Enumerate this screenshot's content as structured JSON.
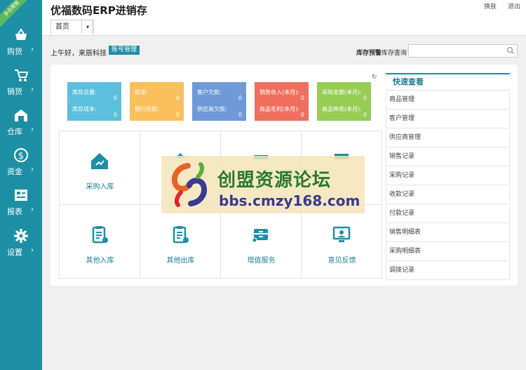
{
  "app": {
    "title": "优福数码ERP进销存",
    "ribbon": "多仓库版"
  },
  "top_links": {
    "switch": "换肤",
    "logout": "退出"
  },
  "tabs": [
    {
      "label": "首页"
    }
  ],
  "greeting": "上午好，来辰科技",
  "account_btn": "账号管理",
  "warning": "库存预警",
  "stock_query": "库存查询",
  "search": {
    "placeholder": "",
    "value": ""
  },
  "sidebar": [
    {
      "label": "购货",
      "icon": "basket-icon"
    },
    {
      "label": "销货",
      "icon": "cart-icon"
    },
    {
      "label": "仓库",
      "icon": "warehouse-icon"
    },
    {
      "label": "资金",
      "icon": "dollar-icon"
    },
    {
      "label": "报表",
      "icon": "report-icon"
    },
    {
      "label": "设置",
      "icon": "gear-icon"
    }
  ],
  "stat_cards": [
    {
      "color": "#5bc0de",
      "l1": "库存总量:",
      "v1": "0",
      "l2": "库存成本:",
      "v2": "0"
    },
    {
      "color": "#f9c05b",
      "l1": "现金:",
      "v1": "0",
      "l2": "银行存款:",
      "v2": "0"
    },
    {
      "color": "#6f9ad7",
      "l1": "客户欠款:",
      "v1": "0",
      "l2": "供应商欠款:",
      "v2": "0"
    },
    {
      "color": "#ef6f5f",
      "l1": "销售收入(本月):",
      "v1": "0",
      "l2": "商品毛利(本月):",
      "v2": "0"
    },
    {
      "color": "#97cc55",
      "l1": "采购金额(本月):",
      "v1": "0",
      "l2": "商品种类(本月):",
      "v2": "0"
    }
  ],
  "grid": [
    {
      "label": "采购入库",
      "icon": "house-icon"
    },
    {
      "label": "",
      "icon": "upload-icon"
    },
    {
      "label": "",
      "icon": "box-icon"
    },
    {
      "label": "",
      "icon": "screen-icon"
    },
    {
      "label": "其他入库",
      "icon": "clipboard-in-icon"
    },
    {
      "label": "其他出库",
      "icon": "clipboard-out-icon"
    },
    {
      "label": "增值服务",
      "icon": "cabinet-icon"
    },
    {
      "label": "意见反馈",
      "icon": "monitor-icon"
    }
  ],
  "quick": {
    "title": "快速查看",
    "items": [
      "商品管理",
      "客户管理",
      "供应商管理",
      "销售记录",
      "采购记录",
      "收款记录",
      "付款记录",
      "销售明细表",
      "采购明细表",
      "调拨记录"
    ]
  },
  "watermark": {
    "cn": "创盟资源论坛",
    "url": "bbs.cmzy168.com"
  },
  "colors": {
    "accent": "#1d8fa5"
  }
}
